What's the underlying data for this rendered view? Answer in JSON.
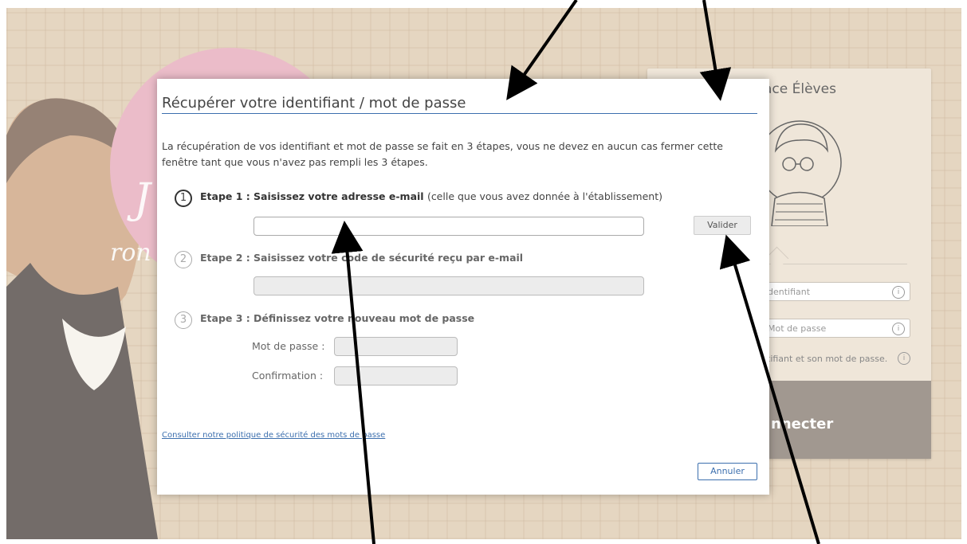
{
  "modal": {
    "title": "Récupérer votre identifiant / mot de passe",
    "intro": "La récupération de vos identifiant et mot de passe se fait en 3 étapes, vous ne devez en aucun cas fermer cette fenêtre tant que vous n'avez pas rempli les 3 étapes.",
    "steps": [
      {
        "number": "1",
        "label": "Etape 1 :",
        "text": "Saisissez votre adresse e-mail",
        "note": "(celle que vous avez donnée à l'établissement)"
      },
      {
        "number": "2",
        "label": "Etape 2 :",
        "text": "Saisissez votre code de sécurité reçu par e-mail"
      },
      {
        "number": "3",
        "label": "Etape 3 :",
        "text": "Définissez votre nouveau mot de passe"
      }
    ],
    "validate_label": "Valider",
    "password_label": "Mot de passe :",
    "confirm_label": "Confirmation :",
    "policy_link": "Consulter notre politique de sécurité des mots de passe",
    "cancel_label": "Annuler"
  },
  "background_panel": {
    "title": "ace Élèves",
    "identifier_placeholder": "dentifiant",
    "password_placeholder": "Mot de passe",
    "hint": "tifiant et son mot de passe.",
    "connect_label": "nnecter",
    "info_glyph": "i"
  },
  "background_brand": {
    "letter": "J",
    "word": "ron"
  },
  "colors": {
    "accent": "#3c6fae",
    "background": "#dcc6a9",
    "pink": "#e3a2b5"
  }
}
